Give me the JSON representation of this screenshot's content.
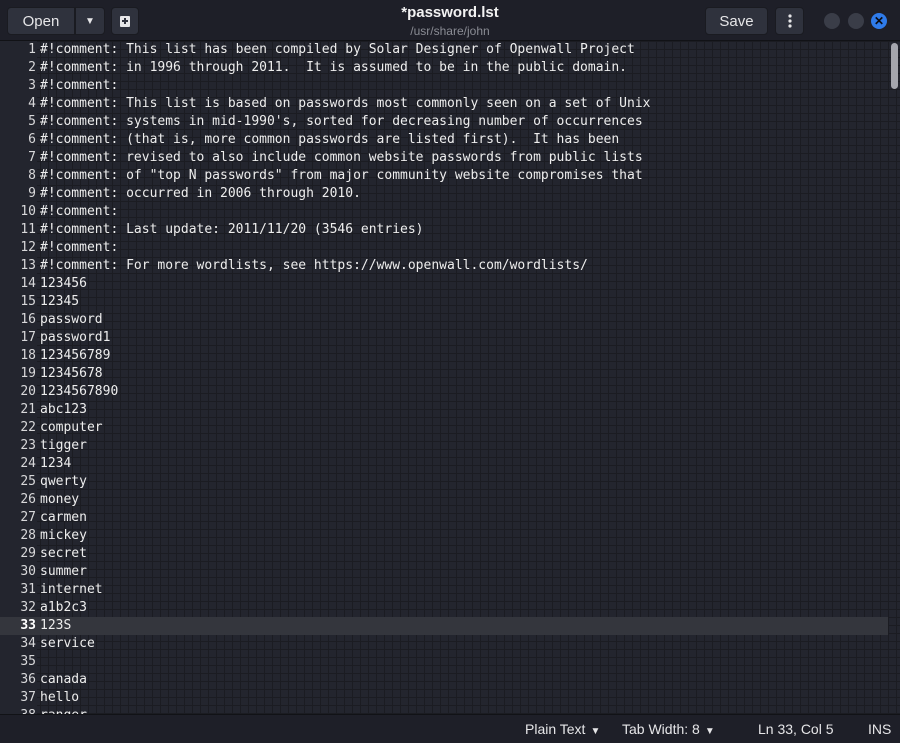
{
  "header": {
    "open_label": "Open",
    "title": "*password.lst",
    "subtitle": "/usr/share/john",
    "save_label": "Save"
  },
  "editor": {
    "current_line": 33,
    "lines": [
      "#!comment: This list has been compiled by Solar Designer of Openwall Project",
      "#!comment: in 1996 through 2011.  It is assumed to be in the public domain.",
      "#!comment:",
      "#!comment: This list is based on passwords most commonly seen on a set of Unix",
      "#!comment: systems in mid-1990's, sorted for decreasing number of occurrences",
      "#!comment: (that is, more common passwords are listed first).  It has been",
      "#!comment: revised to also include common website passwords from public lists",
      "#!comment: of \"top N passwords\" from major community website compromises that",
      "#!comment: occurred in 2006 through 2010.",
      "#!comment:",
      "#!comment: Last update: 2011/11/20 (3546 entries)",
      "#!comment:",
      "#!comment: For more wordlists, see https://www.openwall.com/wordlists/",
      "123456",
      "12345",
      "password",
      "password1",
      "123456789",
      "12345678",
      "1234567890",
      "abc123",
      "computer",
      "tigger",
      "1234",
      "qwerty",
      "money",
      "carmen",
      "mickey",
      "secret",
      "summer",
      "internet",
      "a1b2c3",
      "123S",
      "service",
      "",
      "canada",
      "hello",
      "ranger"
    ]
  },
  "status": {
    "language": "Plain Text",
    "tab_width": "Tab Width: 8",
    "position": "Ln 33, Col 5",
    "mode": "INS"
  }
}
